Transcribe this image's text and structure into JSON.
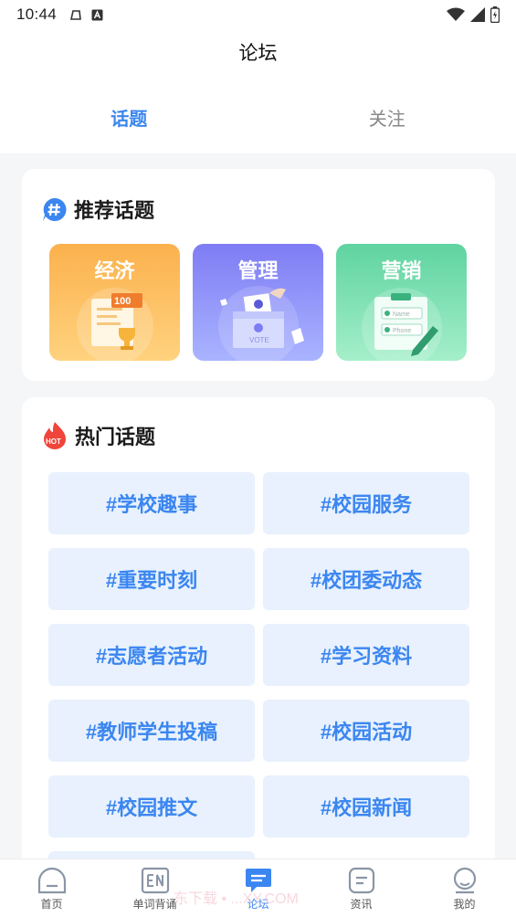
{
  "status_bar": {
    "time": "10:44"
  },
  "header": {
    "title": "论坛"
  },
  "tabs": [
    {
      "label": "话题",
      "active": true
    },
    {
      "label": "关注",
      "active": false
    }
  ],
  "recommended": {
    "title": "推荐话题",
    "tiles": [
      {
        "label": "经济",
        "badge": "100"
      },
      {
        "label": "管理",
        "badge": "VOTE"
      },
      {
        "label": "营销",
        "field1": "Name",
        "field2": "Phone"
      }
    ]
  },
  "hot": {
    "title": "热门话题",
    "badge": "HOT",
    "items": [
      "#学校趣事",
      "#校园服务",
      "#重要时刻",
      "#校团委动态",
      "#志愿者活动",
      "#学习资料",
      "#教师学生投稿",
      "#校园活动",
      "#校园推文",
      "#校园新闻"
    ]
  },
  "bottom_nav": [
    {
      "label": "首页",
      "icon": "home-icon",
      "active": false
    },
    {
      "label": "单词背诵",
      "icon": "en-icon",
      "active": false
    },
    {
      "label": "论坛",
      "icon": "chat-icon",
      "active": true
    },
    {
      "label": "资讯",
      "icon": "news-icon",
      "active": false
    },
    {
      "label": "我的",
      "icon": "profile-icon",
      "active": false
    }
  ],
  "colors": {
    "accent": "#3b86f0",
    "hot_item_bg": "#e8f1fd"
  },
  "watermark": "东下载 • ...XY.COM"
}
